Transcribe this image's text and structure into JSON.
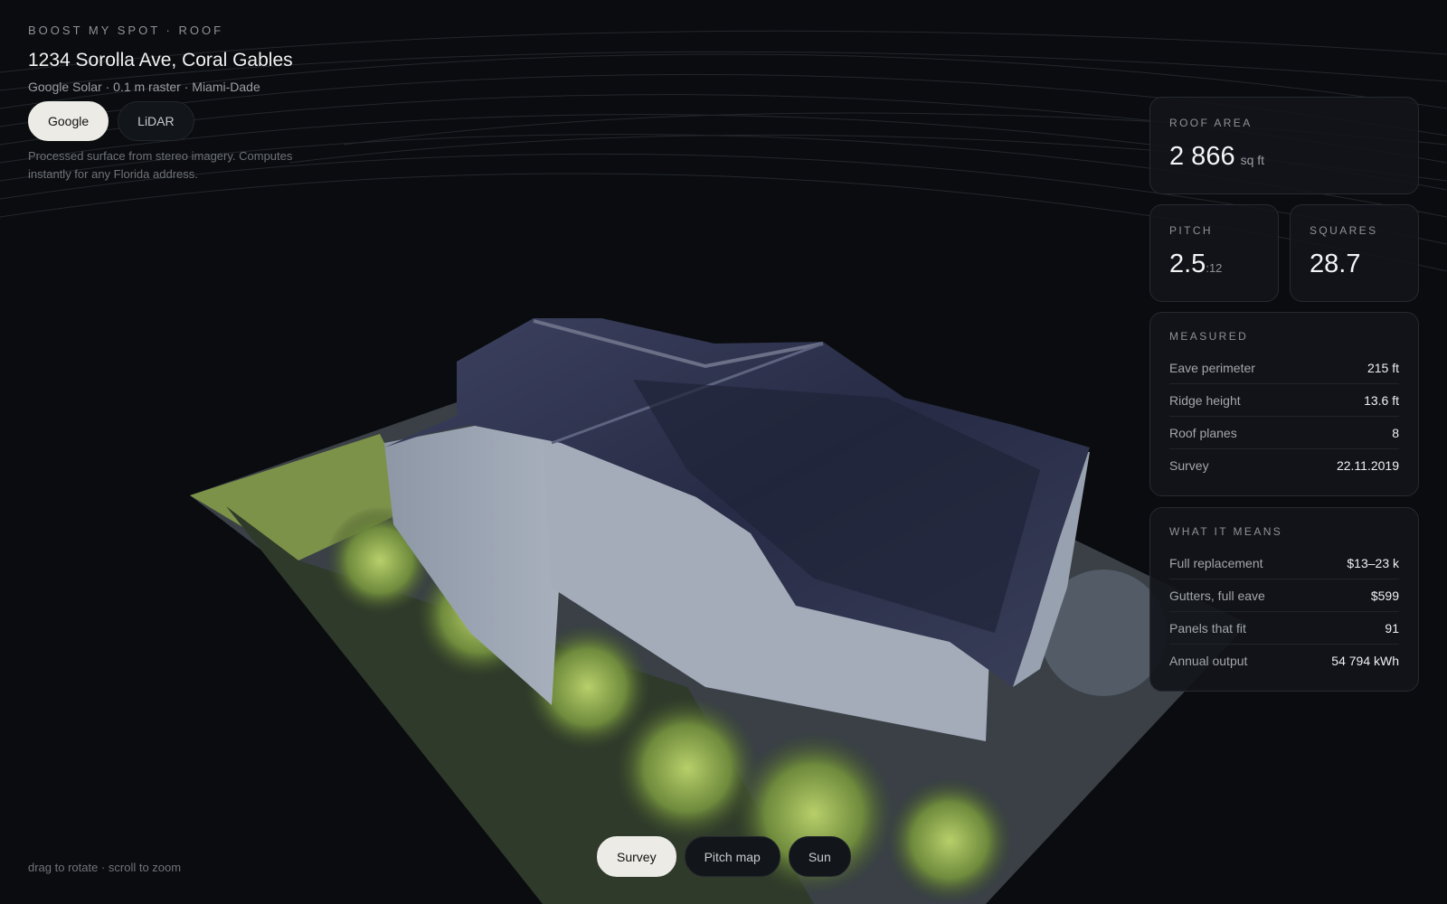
{
  "header": {
    "brand": "BOOST MY SPOT · ROOF",
    "address": "1234 Sorolla Ave, Coral Gables",
    "meta": "Google Solar · 0.1 m raster · Miami-Dade",
    "sources": [
      {
        "label": "Google",
        "active": true
      },
      {
        "label": "LiDAR",
        "active": false
      }
    ],
    "description": "Processed surface from stereo imagery. Computes instantly for any Florida address."
  },
  "roof_area": {
    "label": "ROOF AREA",
    "value": "2 866",
    "unit": "sq ft"
  },
  "pitch": {
    "label": "PITCH",
    "value": "2.5",
    "unit": ":12"
  },
  "squares": {
    "label": "SQUARES",
    "value": "28.7"
  },
  "measured": {
    "label": "MEASURED",
    "rows": [
      {
        "key": "Eave perimeter",
        "value": "215 ft"
      },
      {
        "key": "Ridge height",
        "value": "13.6 ft"
      },
      {
        "key": "Roof planes",
        "value": "8"
      },
      {
        "key": "Survey",
        "value": "22.11.2019"
      }
    ]
  },
  "what_it_means": {
    "label": "WHAT IT MEANS",
    "rows": [
      {
        "key": "Full replacement",
        "value": "$13–23 k"
      },
      {
        "key": "Gutters, full eave",
        "value": "$599"
      },
      {
        "key": "Panels that fit",
        "value": "91"
      },
      {
        "key": "Annual output",
        "value": "54 794 kWh"
      }
    ]
  },
  "footer": {
    "hint": "drag to rotate · scroll to zoom",
    "view_tabs": [
      {
        "label": "Survey",
        "active": true
      },
      {
        "label": "Pitch map",
        "active": false
      },
      {
        "label": "Sun",
        "active": false
      }
    ]
  }
}
